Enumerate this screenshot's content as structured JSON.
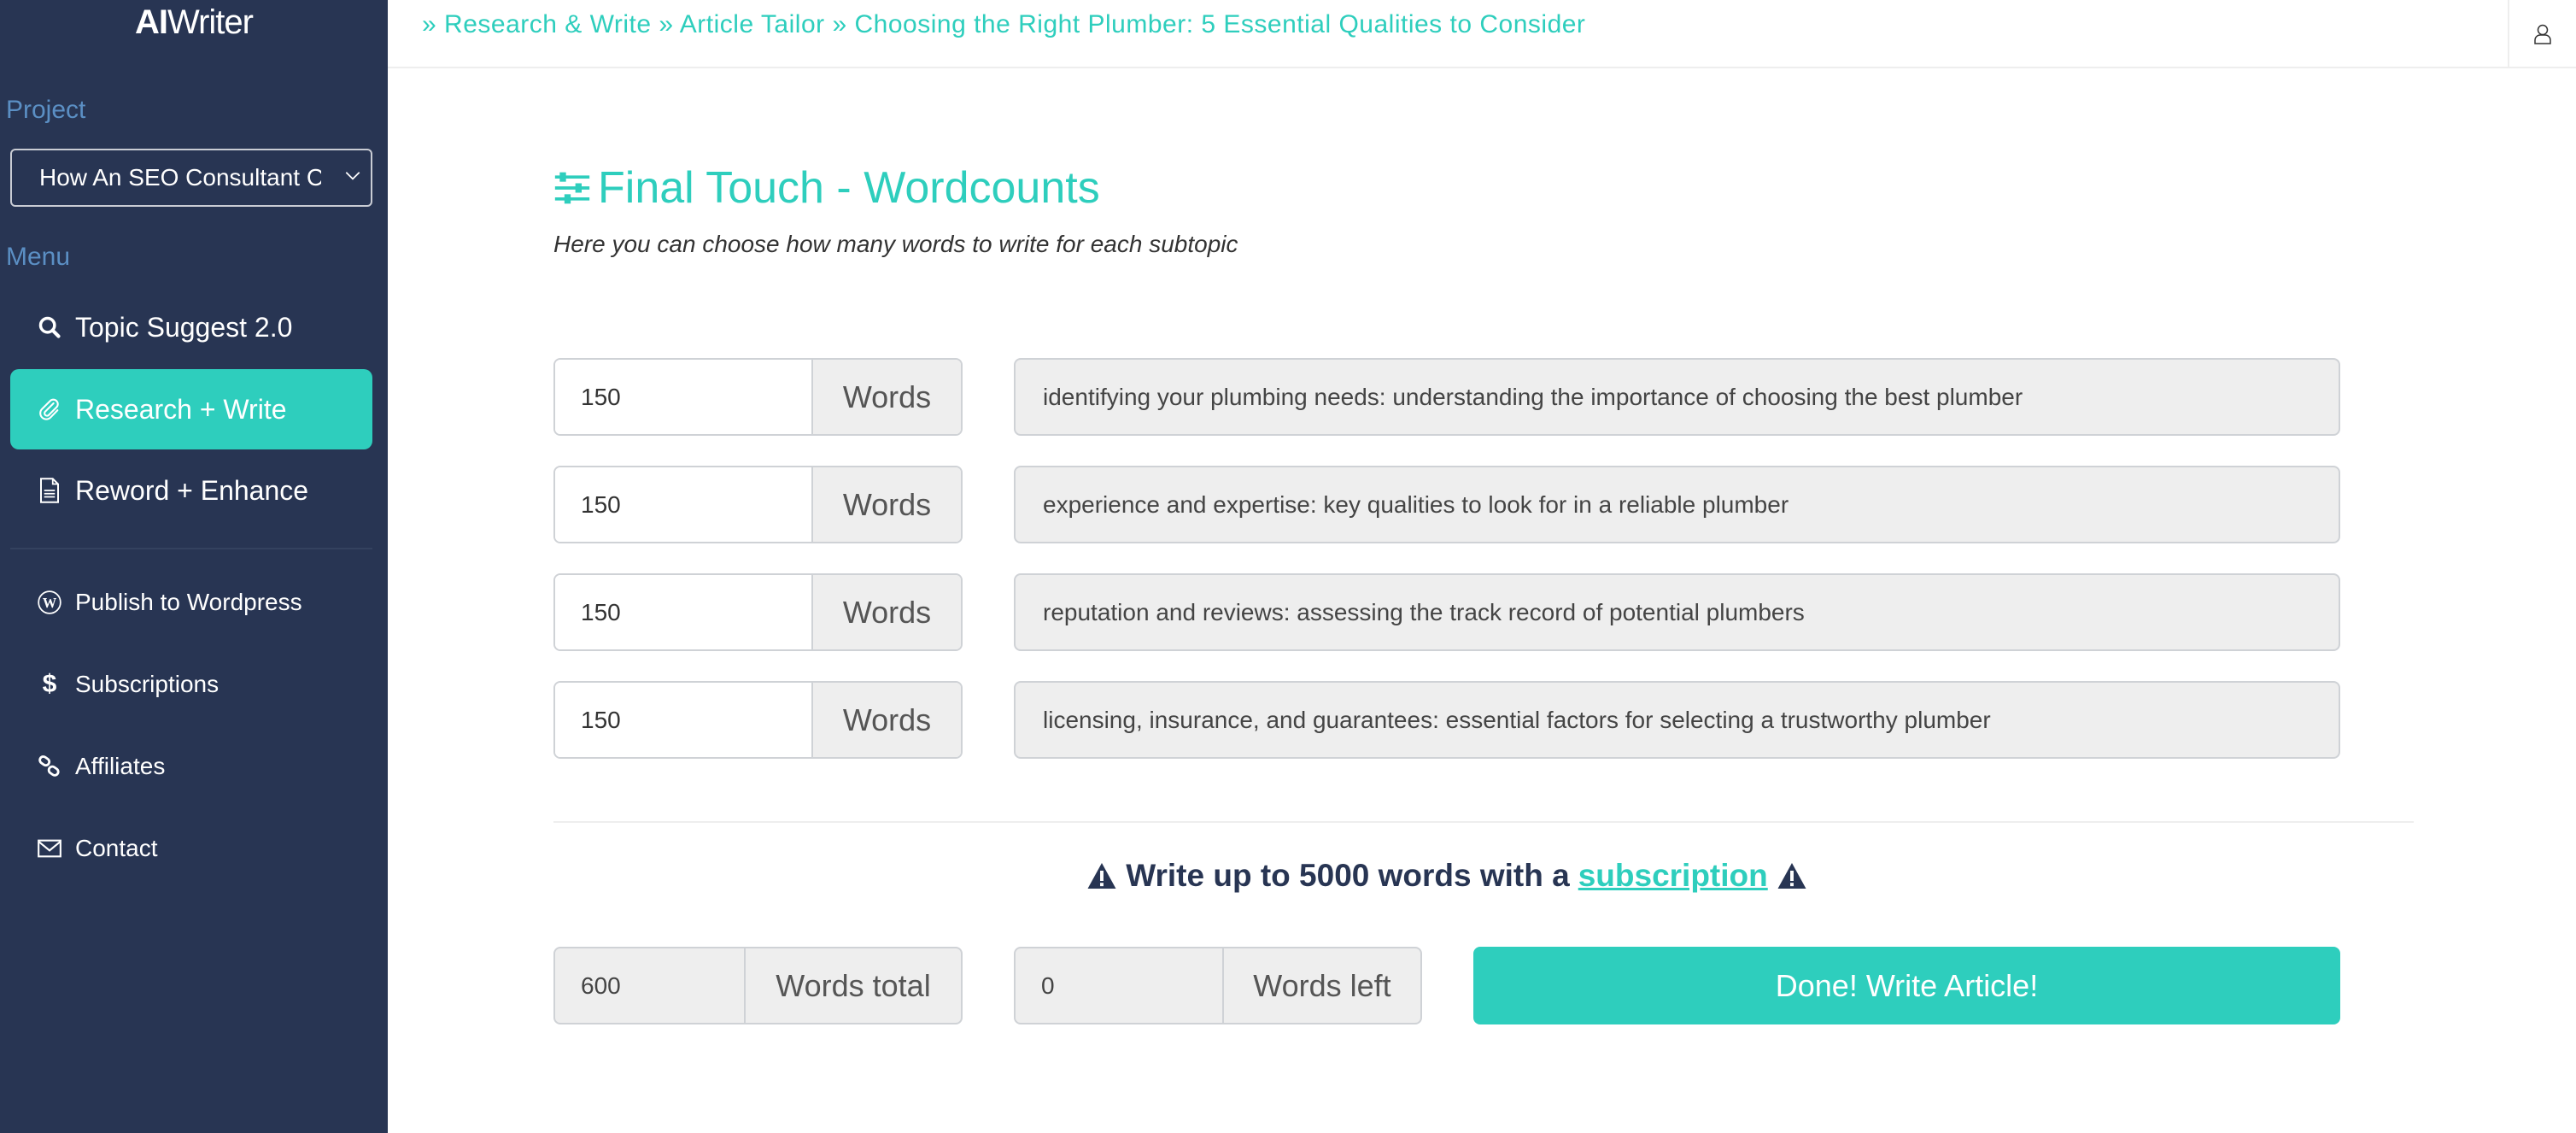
{
  "app": {
    "logo_bold": "AI",
    "logo_light": "Writer"
  },
  "sidebar": {
    "project_label": "Project",
    "project_select_value": "How An SEO Consultant Ca",
    "menu_label": "Menu",
    "items": [
      {
        "label": "Topic Suggest 2.0",
        "icon": "search-icon",
        "active": false
      },
      {
        "label": "Research + Write",
        "icon": "paperclip-icon",
        "active": true
      },
      {
        "label": "Reword + Enhance",
        "icon": "document-icon",
        "active": false
      },
      {
        "label": "Publish to Wordpress",
        "icon": "wordpress-icon",
        "active": false
      },
      {
        "label": "Subscriptions",
        "icon": "dollar-icon",
        "active": false
      },
      {
        "label": "Affiliates",
        "icon": "link-icon",
        "active": false
      },
      {
        "label": "Contact",
        "icon": "envelope-icon",
        "active": false
      }
    ]
  },
  "header": {
    "breadcrumb": [
      {
        "sep": "»",
        "label": "Research & Write"
      },
      {
        "sep": "»",
        "label": "Article Tailor"
      },
      {
        "sep": "»",
        "label": "Choosing the Right Plumber: 5 Essential Qualities to Consider"
      }
    ],
    "user_icon": "user-icon"
  },
  "main": {
    "title": "Final Touch - Wordcounts",
    "title_icon": "sliders-icon",
    "subtitle": "Here you can choose how many words to write for each subtopic",
    "words_unit": "Words",
    "rows": [
      {
        "count": "150",
        "topic": "identifying your plumbing needs: understanding the importance of choosing the best plumber"
      },
      {
        "count": "150",
        "topic": "experience and expertise: key qualities to look for in a reliable plumber"
      },
      {
        "count": "150",
        "topic": "reputation and reviews: assessing the track record of potential plumbers"
      },
      {
        "count": "150",
        "topic": "licensing, insurance, and guarantees: essential factors for selecting a trustworthy plumber"
      }
    ],
    "notice": {
      "prefix": "Write up to 5000 words with a",
      "link": "subscription",
      "icon": "warning-icon"
    },
    "total": {
      "value": "600",
      "label": "Words total"
    },
    "left": {
      "value": "0",
      "label": "Words left"
    },
    "submit_label": "Done! Write Article!"
  },
  "colors": {
    "accent": "#2ecebd",
    "sidebar": "#283553",
    "section_label": "#5b8fc4"
  }
}
